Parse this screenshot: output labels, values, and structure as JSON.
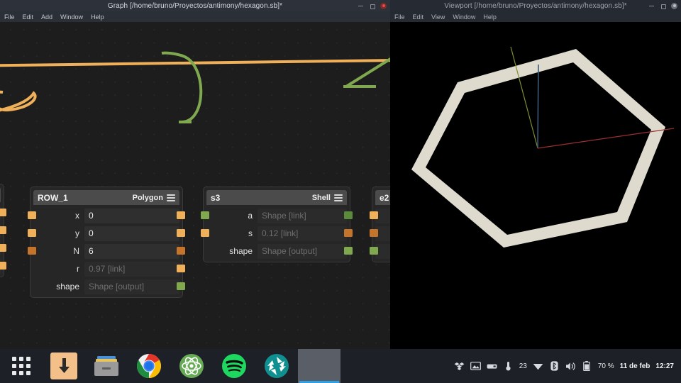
{
  "graph_window": {
    "title": "Graph [/home/bruno/Proyectos/antimony/hexagon.sb]*",
    "menu": [
      "File",
      "Edit",
      "Add",
      "Window",
      "Help"
    ],
    "window_buttons": {
      "minimize": "minimize-icon",
      "maximize": "maximize-icon",
      "close": "close-icon"
    },
    "nodes": [
      {
        "name": "ROW_1",
        "type": "Polygon",
        "menu_icon": "hamburger-menu-icon",
        "rows": [
          {
            "label": "x",
            "value": "0",
            "state": "editable",
            "in_port": "orange",
            "out_port": "orange"
          },
          {
            "label": "y",
            "value": "0",
            "state": "editable",
            "in_port": "orange",
            "out_port": "orange"
          },
          {
            "label": "N",
            "value": "6",
            "state": "editable",
            "in_port": "orange-dark",
            "out_port": "orange-dark"
          },
          {
            "label": "r",
            "value": "0.97 [link]",
            "state": "linked",
            "in_port": "none",
            "out_port": "orange"
          },
          {
            "label": "shape",
            "value": "Shape [output]",
            "state": "output",
            "in_port": "none",
            "out_port": "green"
          }
        ]
      },
      {
        "name": "s3",
        "type": "Shell",
        "menu_icon": "hamburger-menu-icon",
        "rows": [
          {
            "label": "a",
            "value": "Shape [link]",
            "state": "linked",
            "in_port": "green",
            "out_port": "green"
          },
          {
            "label": "s",
            "value": "0.12 [link]",
            "state": "linked",
            "in_port": "orange",
            "out_port": "orange"
          },
          {
            "label": "shape",
            "value": "Shape [output]",
            "state": "output",
            "in_port": "none",
            "out_port": "green"
          }
        ]
      },
      {
        "name": "e2",
        "type": "",
        "menu_icon": "hamburger-menu-icon",
        "rows": [
          {
            "label": "",
            "value": "",
            "state": "linked",
            "in_port": "orange",
            "out_port": "none"
          },
          {
            "label": "",
            "value": "",
            "state": "linked",
            "in_port": "orange",
            "out_port": "none"
          },
          {
            "label": "",
            "value": "",
            "state": "output",
            "in_port": "green",
            "out_port": "none"
          }
        ]
      }
    ]
  },
  "viewport_window": {
    "title": "Viewport [/home/bruno/Proyectos/antimony/hexagon.sb]*",
    "menu": [
      "File",
      "Edit",
      "View",
      "Window",
      "Help"
    ],
    "window_buttons": {
      "minimize": "minimize-icon",
      "maximize": "maximize-icon",
      "close": "close-icon"
    },
    "scene": {
      "object": "hexagon-ring",
      "object_color": "#dedbce",
      "background": "#000000",
      "axes": [
        {
          "name": "x-axis",
          "color": "#9b3030"
        },
        {
          "name": "y-axis",
          "color": "#7f8f32"
        },
        {
          "name": "z-axis",
          "color": "#3c5a78"
        }
      ]
    }
  },
  "taskbar": {
    "launchers": [
      {
        "name": "app-grid",
        "icon": "grid-dots-icon"
      },
      {
        "name": "download-manager",
        "icon": "download-arrow-icon"
      },
      {
        "name": "file-manager",
        "icon": "file-cabinet-icon"
      },
      {
        "name": "chrome",
        "icon": "chrome-icon"
      },
      {
        "name": "atom",
        "icon": "atom-icon"
      },
      {
        "name": "spotify",
        "icon": "spotify-icon"
      },
      {
        "name": "shotwell",
        "icon": "aperture-icon"
      }
    ],
    "window_buttons": [
      {
        "name": "antimony-windows",
        "label": ""
      }
    ],
    "tray": {
      "icons": [
        "dropbox-icon",
        "screenshot-icon",
        "keyboard-icon",
        "temperature-icon"
      ],
      "temperature": "23",
      "network": "wifi-icon",
      "bluetooth": "bluetooth-icon",
      "volume": "volume-icon",
      "battery_icon": "battery-icon",
      "battery_level": "70 %",
      "date": "11 de feb",
      "time": "12:27"
    }
  },
  "colors": {
    "node_head": "#4b4b4b",
    "node_body": "#262626",
    "port_orange": "#f0b05a",
    "port_green": "#7fa84f",
    "wire_orange": "#f0b05a",
    "wire_green": "#7fa84f",
    "canvas_bg": "#1d1d1d",
    "accent_blue": "#2e9fe0"
  }
}
